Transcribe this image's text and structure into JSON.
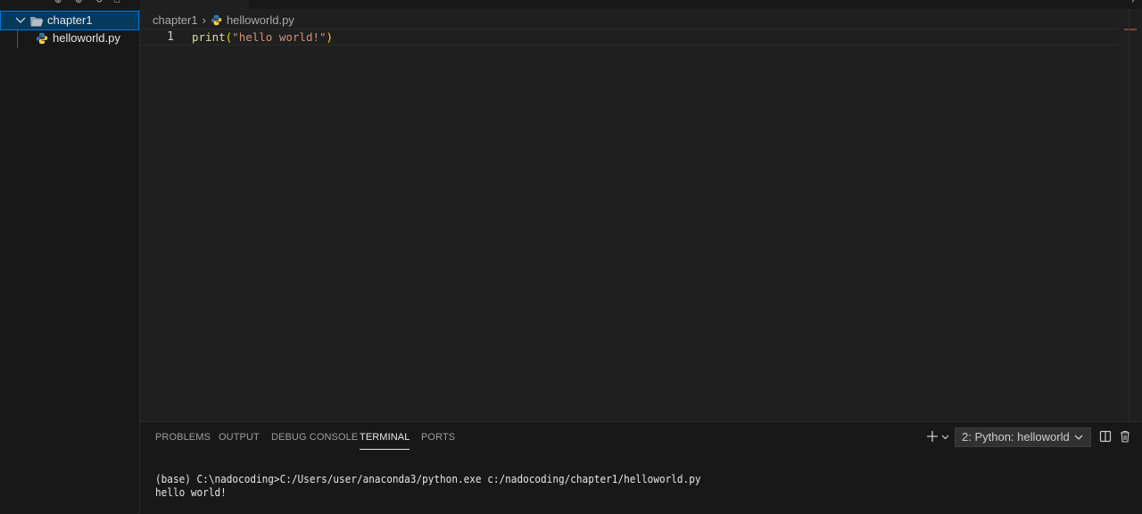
{
  "sidebar": {
    "folder": {
      "label": "chapter1",
      "expanded": true
    },
    "files": [
      {
        "label": "helloworld.py",
        "icon": "python-icon"
      }
    ]
  },
  "editor": {
    "breadcrumb": {
      "folder": "chapter1",
      "file": "helloworld.py"
    },
    "lines": [
      {
        "number": "1",
        "tokens": {
          "fn": "print",
          "open": "(",
          "str": "\"hello world!\"",
          "close": ")"
        }
      }
    ]
  },
  "panel": {
    "tabs": [
      {
        "label": "PROBLEMS",
        "active": false
      },
      {
        "label": "OUTPUT",
        "active": false
      },
      {
        "label": "DEBUG CONSOLE",
        "active": false
      },
      {
        "label": "TERMINAL",
        "active": true
      },
      {
        "label": "PORTS",
        "active": false
      }
    ],
    "terminal_select": "2: Python: helloworld",
    "terminal_lines": [
      "(base) C:\\nadocoding>C:/Users/user/anaconda3/python.exe c:/nadocoding/chapter1/helloworld.py",
      "hello world!"
    ]
  },
  "colors": {
    "accent": "#0078d4",
    "selection": "#04395e",
    "python_blue": "#3776ab",
    "python_yellow": "#ffd43b"
  }
}
